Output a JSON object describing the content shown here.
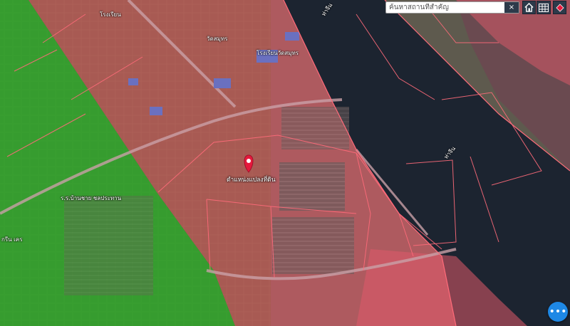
{
  "search": {
    "placeholder": "ค้นหาสถานที่สำคัญ",
    "clear_label": "×"
  },
  "toolbar": {
    "home_icon": "home-icon",
    "grid_icon": "grid-icon",
    "layers_icon": "layers-icon"
  },
  "map": {
    "pin_label": "ตำแหน่งแปลงที่ดิน",
    "places": [
      {
        "name": "โรงเรียน"
      },
      {
        "name": "วัดสมุทร"
      },
      {
        "name": "โรงเรียนวัดสมุทร"
      },
      {
        "name": "ท่าจีน"
      },
      {
        "name": "ท่าจีน"
      },
      {
        "name": "ร.ร.บ้านชาย ชลประทาน"
      },
      {
        "name": "กรีน เคร"
      }
    ]
  },
  "colors": {
    "zone_red": "#e05a6a",
    "zone_green": "#2fae2f",
    "water": "#1c2430",
    "pin": "#e5193c"
  },
  "fab": {
    "label": "•••"
  }
}
